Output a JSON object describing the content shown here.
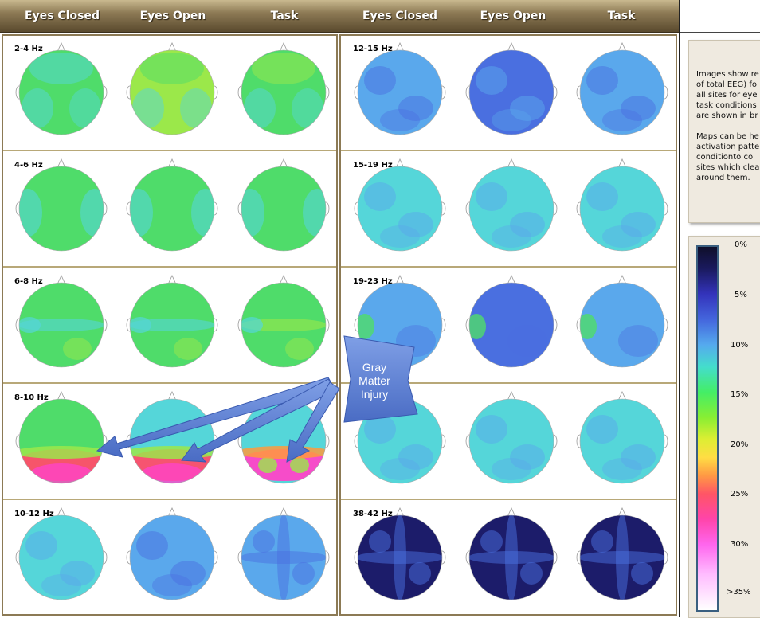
{
  "columns": {
    "left": [
      "Eyes Closed",
      "Eyes Open",
      "Task"
    ],
    "right": [
      "Eyes Closed",
      "Eyes Open",
      "Task"
    ]
  },
  "bands": {
    "left": [
      "2-4 Hz",
      "4-6 Hz",
      "6-8 Hz",
      "8-10 Hz",
      "10-12 Hz"
    ],
    "right": [
      "12-15 Hz",
      "15-19 Hz",
      "19-23 Hz",
      "",
      "38-42 Hz"
    ]
  },
  "info_text": [
    [
      "Images show re",
      "of total EEG) fo",
      "all sites for eye",
      "task conditions",
      "are shown in br"
    ],
    [
      "Maps can be he",
      "activation patte",
      "conditionto co",
      "sites which clea",
      "around them."
    ]
  ],
  "scale_labels": [
    "0%",
    "5%",
    "10%",
    "15%",
    "20%",
    "25%",
    "30%",
    ">35%"
  ],
  "scale_colors": [
    "#0f0f2a",
    "#3333bb",
    "#55aaee",
    "#44ee66",
    "#ddee33",
    "#ff5566",
    "#ff66ee",
    "#ffffff"
  ],
  "callout": {
    "lines": [
      "Gray",
      "Matter",
      "Injury"
    ],
    "color": "#5b7fd1"
  },
  "palette": {
    "green": "#4fdc6a",
    "lime": "#9be84a",
    "cyan": "#55d6d9",
    "sky": "#5aa8ec",
    "blue": "#4a6fe0",
    "navy": "#1c1c6a",
    "red": "#ff4d6a",
    "magenta": "#ff44c8",
    "orange": "#ff9a3c"
  }
}
